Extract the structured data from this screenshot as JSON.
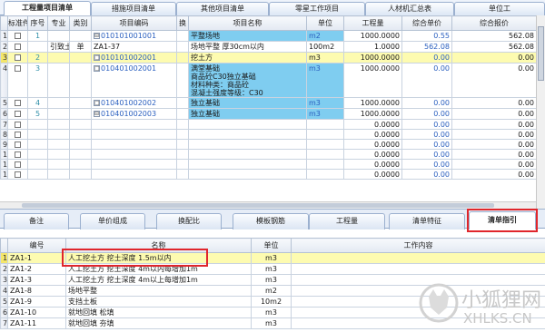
{
  "top_tabs": [
    "工程量项目清单",
    "措施项目清单",
    "其他项目清单",
    "零星工作项目",
    "人材机汇总表",
    "单位工"
  ],
  "upper_grid": {
    "headers": [
      "标准件",
      "序号",
      "专业",
      "类别",
      "项目编码",
      "换",
      "项目名称",
      "单位",
      "工程量",
      "综合单价",
      "综合报价"
    ],
    "rows": [
      {
        "rn": "1",
        "seq": "1",
        "spec": "",
        "cat": "",
        "tree": "⊟",
        "code": "010101001001",
        "chg": "",
        "name": "平整场地",
        "unit": "m2",
        "qty": "1000.0000",
        "price": "0.55",
        "total": "562.08"
      },
      {
        "rn": "2",
        "seq": "",
        "spec": "引致土",
        "cat": "单",
        "tree": "",
        "code": "ZA1-37",
        "chg": "",
        "name": "场地平整 厚30cm以内",
        "unit": "100m2",
        "qty": "1.0000",
        "price": "562.08",
        "total": "562.08"
      },
      {
        "rn": "3",
        "seq": "2",
        "spec": "",
        "cat": "",
        "tree": "□",
        "code": "010101002001",
        "chg": "",
        "name": "挖土方",
        "unit": "m3",
        "qty": "1000.0000",
        "price": "0.00",
        "total": "0.00"
      },
      {
        "rn": "4",
        "seq": "3",
        "spec": "",
        "cat": "",
        "tree": "□",
        "code": "010401002001",
        "chg": "",
        "name": "满堂基础\n商品砼C30独立基础\n材料种类：商品砼\n混凝土强度等级：C30",
        "unit": "m3",
        "qty": "1000.0000",
        "price": "0.00",
        "total": "0.00"
      },
      {
        "rn": "5",
        "seq": "4",
        "spec": "",
        "cat": "",
        "tree": "□",
        "code": "010401002002",
        "chg": "",
        "name": "独立基础",
        "unit": "m3",
        "qty": "1000.0000",
        "price": "0.00",
        "total": "0.00"
      },
      {
        "rn": "6",
        "seq": "5",
        "spec": "",
        "cat": "",
        "tree": "⊟",
        "code": "010401002003",
        "chg": "",
        "name": "独立基础",
        "unit": "m3",
        "qty": "1000.0000",
        "price": "0.00",
        "total": "0.00"
      },
      {
        "rn": "7",
        "seq": "",
        "spec": "",
        "cat": "",
        "tree": "",
        "code": "",
        "chg": "",
        "name": "",
        "unit": "",
        "qty": "0.0000",
        "price": "0.00",
        "total": "0.00"
      },
      {
        "rn": "8",
        "seq": "",
        "spec": "",
        "cat": "",
        "tree": "",
        "code": "",
        "chg": "",
        "name": "",
        "unit": "",
        "qty": "0.0000",
        "price": "0.00",
        "total": "0.00"
      },
      {
        "rn": "9",
        "seq": "",
        "spec": "",
        "cat": "",
        "tree": "",
        "code": "",
        "chg": "",
        "name": "",
        "unit": "",
        "qty": "0.0000",
        "price": "0.00",
        "total": "0.00"
      },
      {
        "rn": "10",
        "seq": "",
        "spec": "",
        "cat": "",
        "tree": "",
        "code": "",
        "chg": "",
        "name": "",
        "unit": "",
        "qty": "0.0000",
        "price": "0.00",
        "total": "0.00"
      },
      {
        "rn": "11",
        "seq": "",
        "spec": "",
        "cat": "",
        "tree": "",
        "code": "",
        "chg": "",
        "name": "",
        "unit": "",
        "qty": "0.0000",
        "price": "0.00",
        "total": "0.00"
      },
      {
        "rn": "12",
        "seq": "",
        "spec": "",
        "cat": "",
        "tree": "",
        "code": "",
        "chg": "",
        "name": "",
        "unit": "",
        "qty": "0.0000",
        "price": "0.00",
        "total": "0.00"
      }
    ]
  },
  "bottom_tabs": [
    "备注",
    "单价组成",
    "换配比",
    "模板钢筋",
    "工程量",
    "清单特征",
    "清单指引"
  ],
  "lower_grid": {
    "headers": [
      "编号",
      "名称",
      "单位",
      "工作内容"
    ],
    "rows": [
      {
        "rn": "1",
        "code": "ZA1-1",
        "name": "人工挖土方 挖土深度 1.5m以内",
        "unit": "m3",
        "work": ""
      },
      {
        "rn": "2",
        "code": "ZA1-2",
        "name": "人工挖土方 挖土深度 4m以内每增加1m",
        "unit": "m3",
        "work": ""
      },
      {
        "rn": "3",
        "code": "ZA1-3",
        "name": "人工挖土方 挖土深度 4m以上每增加1m",
        "unit": "m3",
        "work": ""
      },
      {
        "rn": "4",
        "code": "ZA1-8",
        "name": "场地平整",
        "unit": "m2",
        "work": ""
      },
      {
        "rn": "5",
        "code": "ZA1-9",
        "name": "支挡土板",
        "unit": "10m2",
        "work": ""
      },
      {
        "rn": "6",
        "code": "ZA1-10",
        "name": "就地回填 松填",
        "unit": "m3",
        "work": ""
      },
      {
        "rn": "7",
        "code": "ZA1-11",
        "name": "就地回填 夯填",
        "unit": "m3",
        "work": ""
      }
    ]
  },
  "watermark": {
    "cn": "小狐狸网",
    "en": "XHLKS.CN"
  },
  "colors": {
    "highlight_row": "#fdfbb0",
    "cyan_cell": "#7fcdf0",
    "annotation_red": "#e0262c"
  }
}
